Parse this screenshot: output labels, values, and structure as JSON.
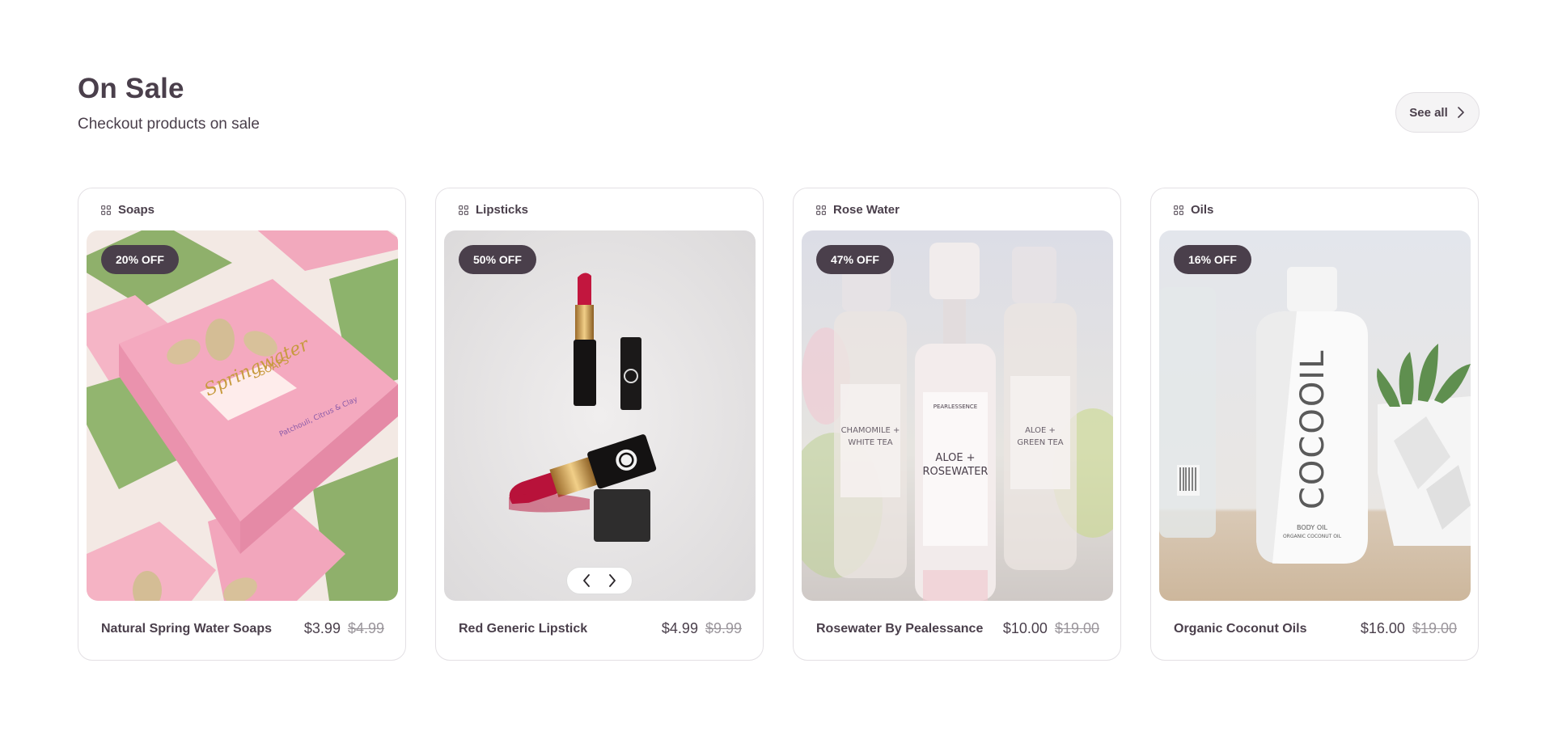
{
  "section": {
    "title": "On Sale",
    "subtitle": "Checkout products on sale",
    "see_all_label": "See all"
  },
  "products": [
    {
      "category": "Soaps",
      "badge": "20% OFF",
      "name": "Natural Spring Water Soaps",
      "price": "$3.99",
      "old_price": "$4.99",
      "image_text": [
        "Springwater",
        "SOAPS",
        "Patchouli, Citrus & Clay"
      ]
    },
    {
      "category": "Lipsticks",
      "badge": "50% OFF",
      "name": "Red Generic Lipstick",
      "price": "$4.99",
      "old_price": "$9.99"
    },
    {
      "category": "Rose Water",
      "badge": "47% OFF",
      "name": "Rosewater By Pealessance",
      "price": "$10.00",
      "old_price": "$19.00",
      "image_text": [
        "PEARLESSENCE",
        "ALOE +",
        "ROSEWATER",
        "CHAMOMILE +",
        "WHITE TEA",
        "ALOE +",
        "GREEN TEA"
      ]
    },
    {
      "category": "Oils",
      "badge": "16% OFF",
      "name": "Organic Coconut Oils",
      "price": "$16.00",
      "old_price": "$19.00",
      "image_text": [
        "COCOOIL",
        "BODY OIL",
        "ORGANIC COCONUT OIL"
      ]
    }
  ],
  "colors": {
    "text": "#4a3f4b",
    "badge_bg": "#4a3f4b",
    "strike": "#9a959b"
  },
  "icons": {
    "category": "grid-icon",
    "see_all": "chevron-right-icon",
    "prev": "chevron-left-icon",
    "next": "chevron-right-icon"
  }
}
